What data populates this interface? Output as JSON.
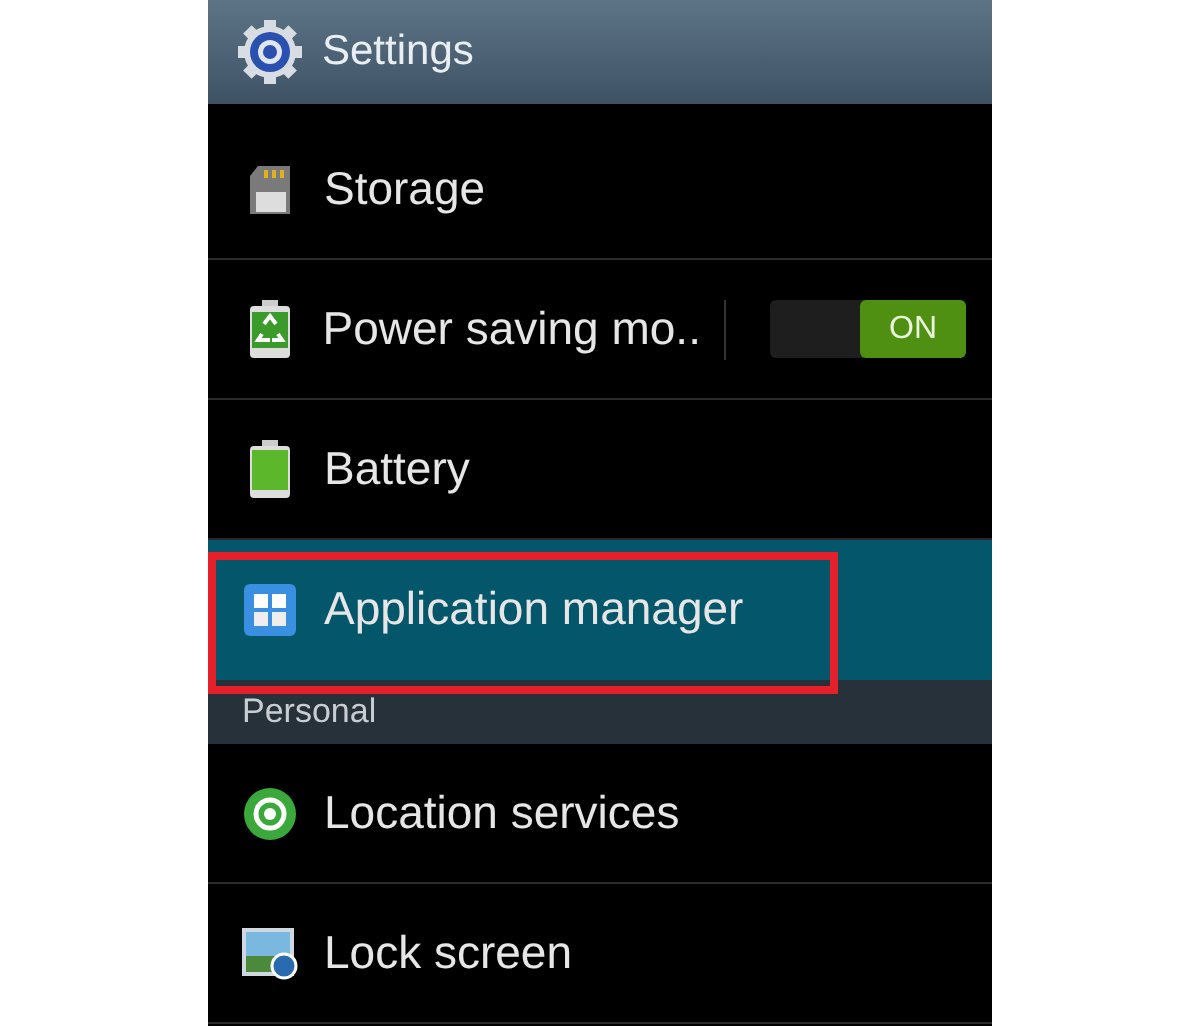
{
  "title_bar": {
    "title": "Settings"
  },
  "list": [
    {
      "kind": "item",
      "label": "Storage",
      "selected": false
    },
    {
      "kind": "toggle",
      "label": "Power saving mo..",
      "on": true,
      "switch_label": "ON",
      "selected": false
    },
    {
      "kind": "item",
      "label": "Battery",
      "selected": false
    },
    {
      "kind": "item",
      "label": "Application manager",
      "selected": true,
      "outlined": true
    },
    {
      "kind": "header",
      "label": "Personal"
    },
    {
      "kind": "item",
      "label": "Location services",
      "selected": false
    },
    {
      "kind": "item",
      "label": "Lock screen",
      "selected": false
    }
  ]
}
